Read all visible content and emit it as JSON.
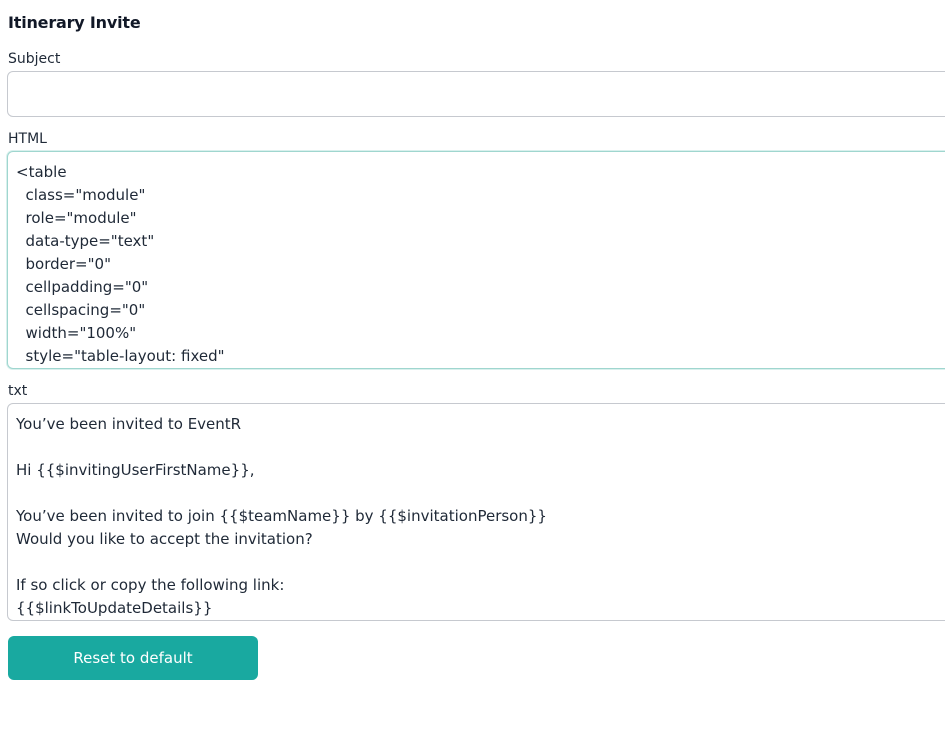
{
  "form": {
    "title": "Itinerary Invite",
    "subject": {
      "label": "Subject",
      "value": ""
    },
    "html": {
      "label": "HTML",
      "lines": [
        "<table",
        "  class=\"module\"",
        "  role=\"module\"",
        "  data-type=\"text\"",
        "  border=\"0\"",
        "  cellpadding=\"0\"",
        "  cellspacing=\"0\"",
        "  width=\"100%\"",
        "  style=\"table-layout: fixed\""
      ]
    },
    "txt": {
      "label": "txt",
      "lines": [
        "You’ve been invited to EventR",
        "",
        "Hi {{$invitingUserFirstName}},",
        "",
        "You’ve been invited to join {{$teamName}} by {{$invitationPerson}}",
        "Would you like to accept the invitation?",
        "",
        "If so click or copy the following link:",
        "{{$linkToUpdateDetails}}"
      ]
    },
    "reset_label": "Reset to default"
  }
}
